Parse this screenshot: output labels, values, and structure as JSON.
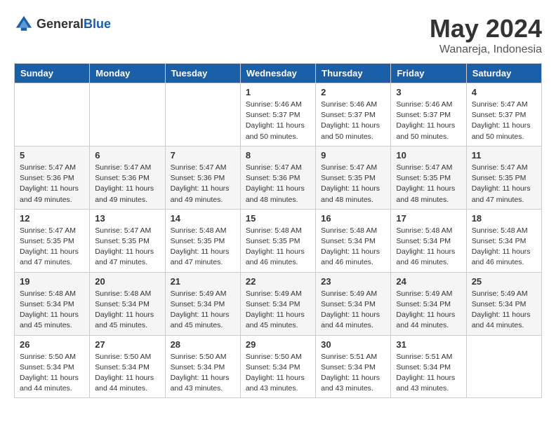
{
  "header": {
    "logo_general": "General",
    "logo_blue": "Blue",
    "title": "May 2024",
    "location": "Wanareja, Indonesia"
  },
  "weekdays": [
    "Sunday",
    "Monday",
    "Tuesday",
    "Wednesday",
    "Thursday",
    "Friday",
    "Saturday"
  ],
  "weeks": [
    [
      {
        "day": "",
        "info": ""
      },
      {
        "day": "",
        "info": ""
      },
      {
        "day": "",
        "info": ""
      },
      {
        "day": "1",
        "info": "Sunrise: 5:46 AM\nSunset: 5:37 PM\nDaylight: 11 hours\nand 50 minutes."
      },
      {
        "day": "2",
        "info": "Sunrise: 5:46 AM\nSunset: 5:37 PM\nDaylight: 11 hours\nand 50 minutes."
      },
      {
        "day": "3",
        "info": "Sunrise: 5:46 AM\nSunset: 5:37 PM\nDaylight: 11 hours\nand 50 minutes."
      },
      {
        "day": "4",
        "info": "Sunrise: 5:47 AM\nSunset: 5:37 PM\nDaylight: 11 hours\nand 50 minutes."
      }
    ],
    [
      {
        "day": "5",
        "info": "Sunrise: 5:47 AM\nSunset: 5:36 PM\nDaylight: 11 hours\nand 49 minutes."
      },
      {
        "day": "6",
        "info": "Sunrise: 5:47 AM\nSunset: 5:36 PM\nDaylight: 11 hours\nand 49 minutes."
      },
      {
        "day": "7",
        "info": "Sunrise: 5:47 AM\nSunset: 5:36 PM\nDaylight: 11 hours\nand 49 minutes."
      },
      {
        "day": "8",
        "info": "Sunrise: 5:47 AM\nSunset: 5:36 PM\nDaylight: 11 hours\nand 48 minutes."
      },
      {
        "day": "9",
        "info": "Sunrise: 5:47 AM\nSunset: 5:35 PM\nDaylight: 11 hours\nand 48 minutes."
      },
      {
        "day": "10",
        "info": "Sunrise: 5:47 AM\nSunset: 5:35 PM\nDaylight: 11 hours\nand 48 minutes."
      },
      {
        "day": "11",
        "info": "Sunrise: 5:47 AM\nSunset: 5:35 PM\nDaylight: 11 hours\nand 47 minutes."
      }
    ],
    [
      {
        "day": "12",
        "info": "Sunrise: 5:47 AM\nSunset: 5:35 PM\nDaylight: 11 hours\nand 47 minutes."
      },
      {
        "day": "13",
        "info": "Sunrise: 5:47 AM\nSunset: 5:35 PM\nDaylight: 11 hours\nand 47 minutes."
      },
      {
        "day": "14",
        "info": "Sunrise: 5:48 AM\nSunset: 5:35 PM\nDaylight: 11 hours\nand 47 minutes."
      },
      {
        "day": "15",
        "info": "Sunrise: 5:48 AM\nSunset: 5:35 PM\nDaylight: 11 hours\nand 46 minutes."
      },
      {
        "day": "16",
        "info": "Sunrise: 5:48 AM\nSunset: 5:34 PM\nDaylight: 11 hours\nand 46 minutes."
      },
      {
        "day": "17",
        "info": "Sunrise: 5:48 AM\nSunset: 5:34 PM\nDaylight: 11 hours\nand 46 minutes."
      },
      {
        "day": "18",
        "info": "Sunrise: 5:48 AM\nSunset: 5:34 PM\nDaylight: 11 hours\nand 46 minutes."
      }
    ],
    [
      {
        "day": "19",
        "info": "Sunrise: 5:48 AM\nSunset: 5:34 PM\nDaylight: 11 hours\nand 45 minutes."
      },
      {
        "day": "20",
        "info": "Sunrise: 5:48 AM\nSunset: 5:34 PM\nDaylight: 11 hours\nand 45 minutes."
      },
      {
        "day": "21",
        "info": "Sunrise: 5:49 AM\nSunset: 5:34 PM\nDaylight: 11 hours\nand 45 minutes."
      },
      {
        "day": "22",
        "info": "Sunrise: 5:49 AM\nSunset: 5:34 PM\nDaylight: 11 hours\nand 45 minutes."
      },
      {
        "day": "23",
        "info": "Sunrise: 5:49 AM\nSunset: 5:34 PM\nDaylight: 11 hours\nand 44 minutes."
      },
      {
        "day": "24",
        "info": "Sunrise: 5:49 AM\nSunset: 5:34 PM\nDaylight: 11 hours\nand 44 minutes."
      },
      {
        "day": "25",
        "info": "Sunrise: 5:49 AM\nSunset: 5:34 PM\nDaylight: 11 hours\nand 44 minutes."
      }
    ],
    [
      {
        "day": "26",
        "info": "Sunrise: 5:50 AM\nSunset: 5:34 PM\nDaylight: 11 hours\nand 44 minutes."
      },
      {
        "day": "27",
        "info": "Sunrise: 5:50 AM\nSunset: 5:34 PM\nDaylight: 11 hours\nand 44 minutes."
      },
      {
        "day": "28",
        "info": "Sunrise: 5:50 AM\nSunset: 5:34 PM\nDaylight: 11 hours\nand 43 minutes."
      },
      {
        "day": "29",
        "info": "Sunrise: 5:50 AM\nSunset: 5:34 PM\nDaylight: 11 hours\nand 43 minutes."
      },
      {
        "day": "30",
        "info": "Sunrise: 5:51 AM\nSunset: 5:34 PM\nDaylight: 11 hours\nand 43 minutes."
      },
      {
        "day": "31",
        "info": "Sunrise: 5:51 AM\nSunset: 5:34 PM\nDaylight: 11 hours\nand 43 minutes."
      },
      {
        "day": "",
        "info": ""
      }
    ]
  ]
}
